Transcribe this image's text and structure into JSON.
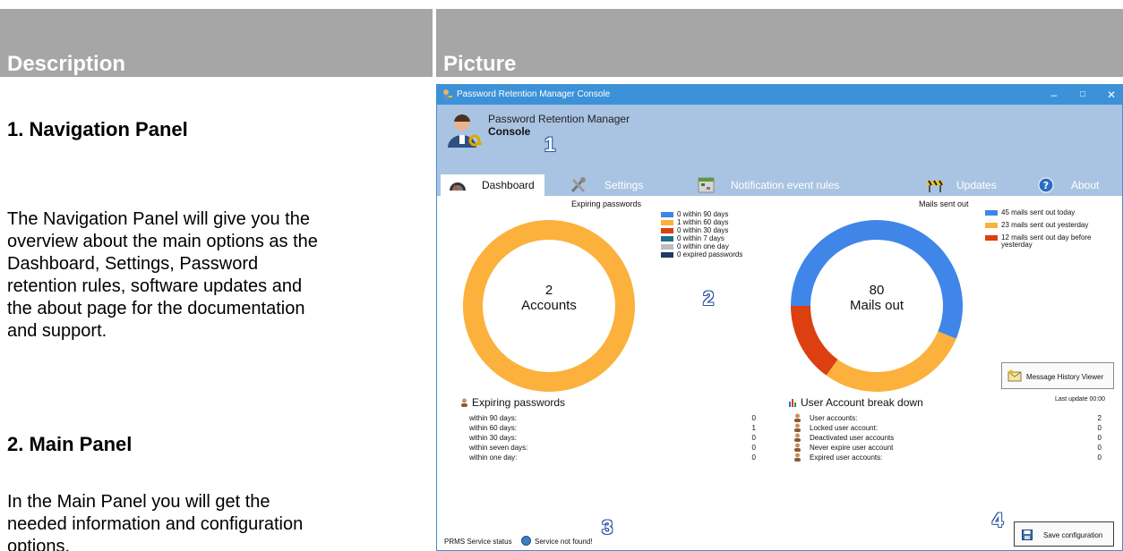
{
  "table": {
    "header_left": "Description",
    "header_right": "Picture"
  },
  "doc": {
    "sections": [
      {
        "title": "1. Navigation Panel",
        "lines": [
          "The Navigation Panel will give you the",
          "overview about the main options as the",
          "Dashboard, Settings, Password",
          "retention rules, software updates and",
          "the about page for the documentation",
          "and support."
        ]
      },
      {
        "title": "2. Main Panel",
        "lines": [
          "In the Main Panel you will get the",
          "needed information and configuration",
          "options."
        ]
      }
    ]
  },
  "app": {
    "window_title": "Password Retention Manager Console",
    "title": "Password Retention Manager",
    "subtitle": "Console",
    "tabs": [
      {
        "label": "Dashboard",
        "icon": "speedometer-icon",
        "active": true
      },
      {
        "label": "Settings",
        "icon": "tools-icon",
        "active": false
      },
      {
        "label": "Notification event rules",
        "icon": "calendar-icon",
        "active": false
      },
      {
        "label": "Updates",
        "icon": "barrier-icon",
        "active": false
      },
      {
        "label": "About",
        "icon": "help-icon",
        "active": false
      }
    ],
    "callouts": [
      "1",
      "2",
      "3",
      "4"
    ],
    "colors": {
      "accent": "#3c92d8",
      "header_bg": "#a9c4e2",
      "orange": "#fbb13c",
      "blue": "#3f86e8",
      "red": "#dc3f10"
    }
  },
  "dashboard": {
    "expiring": {
      "title": "Expiring passwords",
      "center_number": "2",
      "center_label": "Accounts",
      "legend": [
        {
          "label": "0 within 90 days",
          "color": "#3f86e8"
        },
        {
          "label": "1 within 60 days",
          "color": "#fbb13c"
        },
        {
          "label": "0 within 30 days",
          "color": "#dc3f10"
        },
        {
          "label": "0 within 7 days",
          "color": "#1a6f8a"
        },
        {
          "label": "0 within one day",
          "color": "#bdbdbd"
        },
        {
          "label": "0 expired passwords",
          "color": "#1f3864"
        }
      ]
    },
    "mails": {
      "title": "Mails sent out",
      "center_number": "80",
      "center_label": "Mails out",
      "legend": [
        {
          "label": "45 mails sent out today",
          "color": "#3f86e8"
        },
        {
          "label": "23 mails sent out yesterday",
          "color": "#fbb13c"
        },
        {
          "label": "12 mails sent out day before",
          "label2": "yesterday",
          "color": "#dc3f10"
        }
      ]
    },
    "message_history_button": "Message History Viewer",
    "last_update": "Last update 00:00",
    "expiring_stats": {
      "heading": "Expiring passwords",
      "rows": [
        {
          "label": "within 90 days:",
          "value": "0"
        },
        {
          "label": "within 60 days:",
          "value": "1"
        },
        {
          "label": "within 30 days:",
          "value": "0"
        },
        {
          "label": "within seven days:",
          "value": "0"
        },
        {
          "label": "within one day:",
          "value": "0"
        }
      ]
    },
    "breakdown": {
      "heading": "User Account break down",
      "rows": [
        {
          "label": "User accounts:",
          "value": "2"
        },
        {
          "label": "Locked user account:",
          "value": "0"
        },
        {
          "label": "Deactivated user accounts",
          "value": "0"
        },
        {
          "label": "Never expire user account",
          "value": "0"
        },
        {
          "label": "Expired user accounts:",
          "value": "0"
        }
      ]
    },
    "status_label": "PRMS Service status",
    "status_message": "Service not found!",
    "save_button": "Save configuration"
  },
  "chart_data": [
    {
      "type": "pie",
      "title": "Expiring passwords",
      "categories": [
        "0 within 90 days",
        "1 within 60 days",
        "0 within 30 days",
        "0 within 7 days",
        "0 within one day",
        "0 expired passwords"
      ],
      "values": [
        0,
        1,
        0,
        0,
        0,
        0
      ]
    },
    {
      "type": "pie",
      "title": "Mails sent out",
      "categories": [
        "45 mails sent out today",
        "23 mails sent out yesterday",
        "12 mails sent out day before yesterday"
      ],
      "values": [
        45,
        23,
        12
      ]
    }
  ]
}
